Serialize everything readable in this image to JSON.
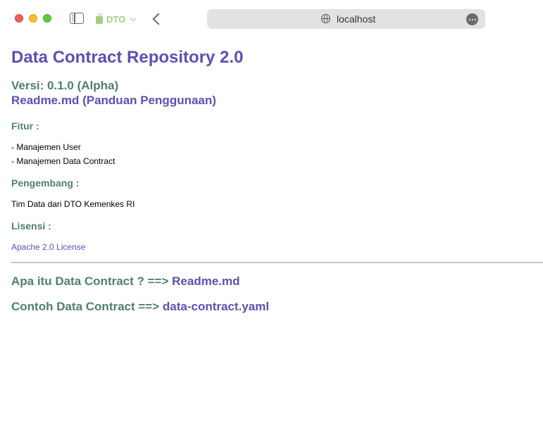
{
  "browser": {
    "tab_group_label": "DTO",
    "address": "localhost",
    "colors": {
      "close": "#ee5f57",
      "minimize": "#f5bd2f",
      "maximize": "#5cc93f",
      "tab_group": "#a6cd84",
      "address_bg": "#e2e2e2"
    }
  },
  "page": {
    "title": "Data Contract Repository 2.0",
    "version": "Versi: 0.1.0 (Alpha)",
    "readme_link": "Readme.md (Panduan Penggunaan)",
    "features": {
      "heading": "Fitur :",
      "items": [
        "- Manajemen User",
        "- Manajemen Data Contract"
      ]
    },
    "developer": {
      "heading": "Pengembang :",
      "text": "Tim Data dari DTO Kemenkes RI"
    },
    "license": {
      "heading": "Lisensi :",
      "link": "Apache 2.0 License"
    },
    "what_is": {
      "prefix": "Apa itu Data Contract ? ==>",
      "link": "Readme.md"
    },
    "example": {
      "prefix": "Contoh Data Contract ==>",
      "link": "data-contract.yaml"
    },
    "colors": {
      "link": "#5a50b4",
      "heading_teal": "#4f7f72",
      "divider": "#c8c8c8"
    }
  }
}
